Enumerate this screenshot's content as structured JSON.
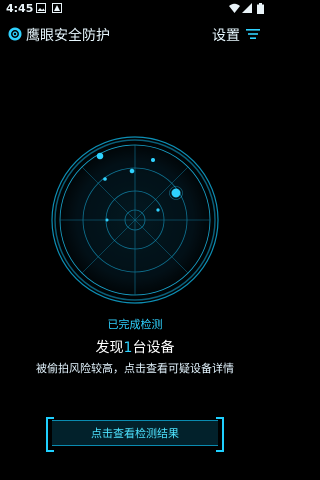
{
  "status_bar": {
    "time": "4:45"
  },
  "header": {
    "app_title": "鹰眼安全防护",
    "settings_label": "设置"
  },
  "result": {
    "status": "已完成检测",
    "found_prefix": "发现",
    "found_count": "1",
    "found_suffix": "台设备",
    "description": "被偷拍风险较高，点击查看可疑设备详情"
  },
  "action": {
    "button_label": "点击查看检测结果"
  },
  "colors": {
    "accent": "#2fd2ff",
    "background": "#000000"
  },
  "icons": [
    "app-logo-icon",
    "filter-icon",
    "wifi-icon",
    "signal-icon",
    "battery-icon"
  ]
}
